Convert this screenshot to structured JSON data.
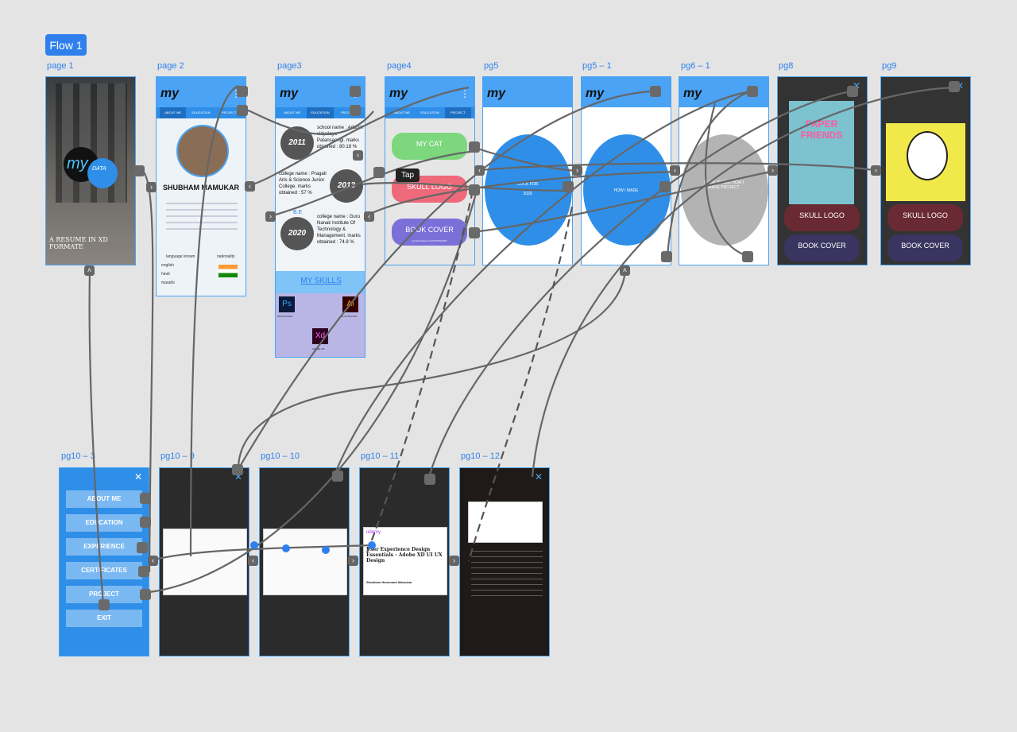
{
  "flow": {
    "label": "Flow 1"
  },
  "artboards": {
    "page1": {
      "label": "page 1",
      "logo_my": "my",
      "logo_data": "DATA",
      "tagline": "A RESUME IN XD FORMATE"
    },
    "page2": {
      "label": "page 2",
      "name": "SHUBHAM MAMUKAR",
      "tabs": [
        "ABOUT ME",
        "EDUCATION",
        "PROJECT"
      ],
      "language_label": "language known",
      "nationality_label": "nationality",
      "languages": [
        "english",
        "hindi",
        "marathi"
      ]
    },
    "page3": {
      "label": "page3",
      "years": [
        "2011",
        "2013",
        "2020"
      ],
      "degree": "B.E",
      "school_text": "school name : Adarsh vidyalaya Patansaongi. marks obtained : 80.18 %",
      "college_text": "college name : Pragati Arts & Science Junior College. marks obtained : 57 %",
      "college2_text": "college name : Guru Nanak Institute Of Technology & Management. marks obtained : 74.8 %",
      "skills_title": "MY SKILLS",
      "ps": "Ps",
      "ai": "Ai",
      "xd": "Xd",
      "ps_label": "PHOTOSHOP",
      "ai_label": "ILLUSTRATOR",
      "xd_label": "ADOBE XD"
    },
    "page4": {
      "label": "page4",
      "btn1": "MY CAT",
      "btn2": "SKULL LOGO",
      "btn3": "BOOK COVER",
      "btn3_sub": "(project based on PHOTOSHOP)"
    },
    "pg5": {
      "label": "pg5",
      "circle_text": "CLICK FOR",
      "year": "2020"
    },
    "pg5_1": {
      "label": "pg5 – 1",
      "circle_text": "HOW I MADE"
    },
    "pg6_1": {
      "label": "pg6 – 1",
      "circle_text": "CLICK TO SEE HOW I MADE PROJECT"
    },
    "pg8": {
      "label": "pg8",
      "book_title": "PAPER FRIENDS",
      "btn2": "SKULL LOGO",
      "btn3": "BOOK COVER"
    },
    "pg9": {
      "label": "pg9",
      "btn2": "SKULL LOGO",
      "btn3": "BOOK COVER"
    },
    "pg10_3": {
      "label": "pg10 – 3",
      "menu": [
        "ABOUT ME",
        "EDUCATION",
        "EXPERIENCE",
        "CERTIFICATES",
        "PROJECT",
        "EXIT"
      ]
    },
    "pg10_9": {
      "label": "pg10 – 9"
    },
    "pg10_10": {
      "label": "pg10 – 10"
    },
    "pg10_11": {
      "label": "pg10 – 11",
      "cert_brand": "üdemy",
      "cert_title": "User Experience Design Essentials - Adobe XD UI UX Design",
      "cert_name": "Shubham Hanumant Mamukar"
    },
    "pg10_12": {
      "label": "pg10 – 12"
    }
  },
  "tooltip": {
    "text": "Tap"
  },
  "colors": {
    "accent": "#2f80ed",
    "artboard_border": "#4aa3f5",
    "wire": "#666666"
  }
}
